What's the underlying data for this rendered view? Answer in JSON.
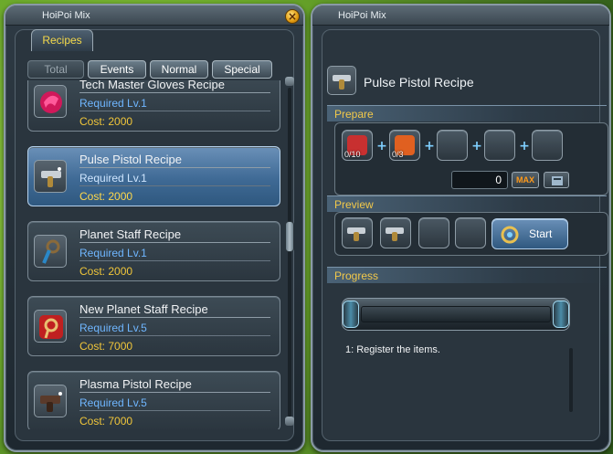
{
  "left_window": {
    "title": "HoiPoi Mix",
    "tab": "Recipes",
    "filters": [
      "Total",
      "Events",
      "Normal",
      "Special"
    ],
    "recipes": [
      {
        "name": "Tech Master Gloves Recipe",
        "level": "Required Lv.1",
        "cost": "Cost: 2000",
        "icon": "gloves-icon",
        "icon_color": "#d0185a"
      },
      {
        "name": "Pulse Pistol Recipe",
        "level": "Required Lv.1",
        "cost": "Cost: 2000",
        "icon": "pistol-icon",
        "icon_color": "#b9c0c6",
        "selected": true
      },
      {
        "name": "Planet Staff Recipe",
        "level": "Required Lv.1",
        "cost": "Cost: 2000",
        "icon": "staff-icon",
        "icon_color": "#2a88c8"
      },
      {
        "name": "New Planet Staff Recipe",
        "level": "Required Lv.5",
        "cost": "Cost: 7000",
        "icon": "staff-icon",
        "icon_color": "#c02020"
      },
      {
        "name": "Plasma Pistol Recipe",
        "level": "Required Lv.5",
        "cost": "Cost: 7000",
        "icon": "pistol-icon",
        "icon_color": "#5a3a2a"
      }
    ]
  },
  "right_window": {
    "title": "HoiPoi Mix",
    "recipe_name": "Pulse Pistol Recipe",
    "prepare_label": "Prepare",
    "prepare_slots": [
      {
        "count": "0/10",
        "color": "#c83030",
        "filled": true
      },
      {
        "count": "0/3",
        "color": "#e06020",
        "filled": true
      },
      {
        "count": "",
        "filled": false
      },
      {
        "count": "",
        "filled": false
      },
      {
        "count": "",
        "filled": false
      }
    ],
    "quantity": "0",
    "max_label": "MAX",
    "preview_label": "Preview",
    "start_label": "Start",
    "progress_label": "Progress",
    "progress_message": "1: Register the items."
  },
  "colors": {
    "accent_yellow": "#f2c94a",
    "level_blue": "#6fb6ff",
    "selected_blue": "#3f6a95"
  }
}
